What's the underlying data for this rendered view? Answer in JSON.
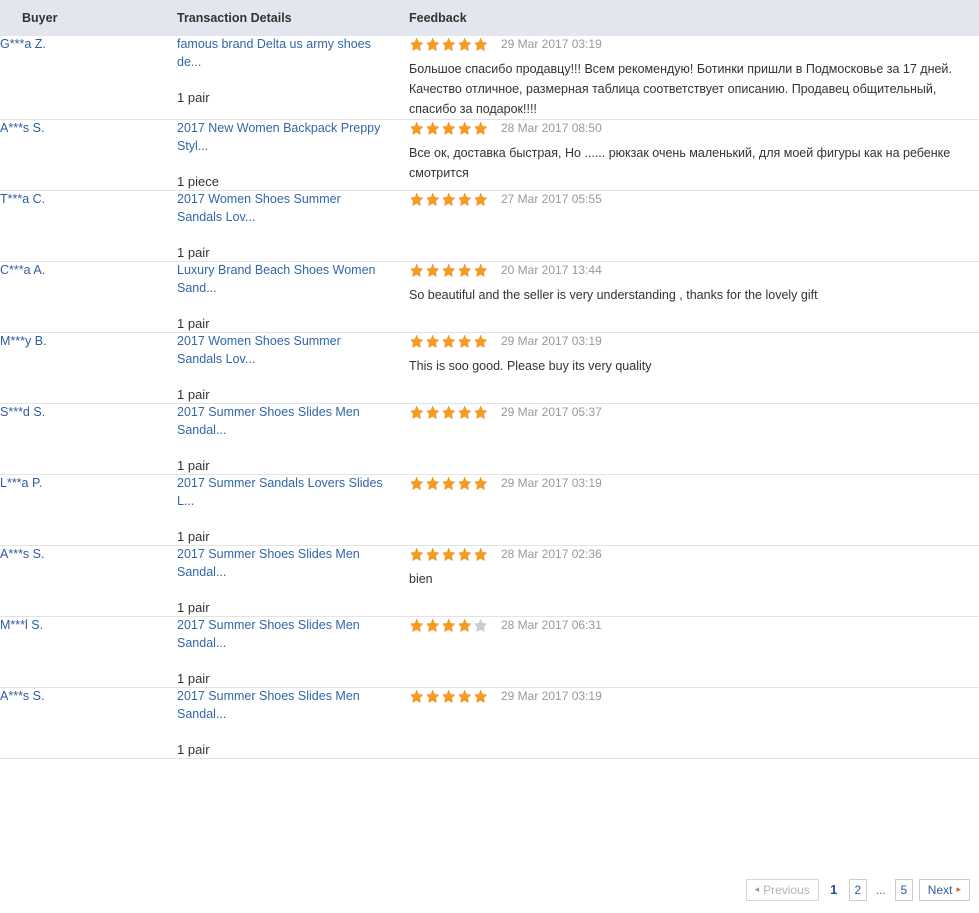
{
  "table": {
    "columns": {
      "buyer": "Buyer",
      "transaction": "Transaction Details",
      "feedback": "Feedback"
    },
    "rows": [
      {
        "buyer": "G***a Z.",
        "product": "famous brand Delta us army shoes de...",
        "quantity": "1 pair",
        "rating": 5,
        "date": "29 Mar 2017 03:19",
        "comment": "Большое спасибо продавцу!!! Всем рекомендую! Ботинки пришли в Подмосковье за 17 дней. Качество отличное, размерная таблица соответствует описанию. Продавец общительный, спасибо за подарок!!!!"
      },
      {
        "buyer": "A***s S.",
        "product": "2017 New Women Backpack Preppy Styl...",
        "quantity": "1 piece",
        "rating": 5,
        "date": "28 Mar 2017 08:50",
        "comment": "Все ок, доставка быстрая, Но ...... рюкзак очень маленький, для моей фигуры как на ребенке смотрится"
      },
      {
        "buyer": "T***a C.",
        "product": "2017 Women Shoes Summer Sandals Lov...",
        "quantity": "1 pair",
        "rating": 5,
        "date": "27 Mar 2017 05:55",
        "comment": ""
      },
      {
        "buyer": "C***a A.",
        "product": "Luxury Brand Beach Shoes Women Sand...",
        "quantity": "1 pair",
        "rating": 5,
        "date": "20 Mar 2017 13:44",
        "comment": "So beautiful and the seller is very understanding , thanks for the lovely gift"
      },
      {
        "buyer": "M***y B.",
        "product": "2017 Women Shoes Summer Sandals Lov...",
        "quantity": "1 pair",
        "rating": 5,
        "date": "29 Mar 2017 03:19",
        "comment": "This is soo good. Please buy its very quality"
      },
      {
        "buyer": "S***d S.",
        "product": "2017 Summer Shoes Slides Men Sandal...",
        "quantity": "1 pair",
        "rating": 5,
        "date": "29 Mar 2017 05:37",
        "comment": ""
      },
      {
        "buyer": "L***a P.",
        "product": "2017 Summer Sandals Lovers Slides L...",
        "quantity": "1 pair",
        "rating": 5,
        "date": "29 Mar 2017 03:19",
        "comment": ""
      },
      {
        "buyer": "A***s S.",
        "product": "2017 Summer Shoes Slides Men Sandal...",
        "quantity": "1 pair",
        "rating": 5,
        "date": "28 Mar 2017 02:36",
        "comment": "bien"
      },
      {
        "buyer": "M***l S.",
        "product": "2017 Summer Shoes Slides Men Sandal...",
        "quantity": "1 pair",
        "rating": 4,
        "date": "28 Mar 2017 06:31",
        "comment": ""
      },
      {
        "buyer": "A***s S.",
        "product": "2017 Summer Shoes Slides Men Sandal...",
        "quantity": "1 pair",
        "rating": 5,
        "date": "29 Mar 2017 03:19",
        "comment": ""
      }
    ]
  },
  "pagination": {
    "previous_label": "Previous",
    "previous_icon": "triangle-left-icon",
    "next_label": "Next",
    "next_icon": "triangle-right-icon",
    "pages": [
      "1",
      "2",
      "...",
      "5"
    ],
    "current_page": "1",
    "ellipsis": "..."
  },
  "colors": {
    "header_bg": "#e4e6ef",
    "link": "#3266a8",
    "star_filled": "#f79b21",
    "star_empty": "#cccccc",
    "date_text": "#999999",
    "row_border": "#e3e3e3",
    "next_arrow": "#e4591f"
  }
}
